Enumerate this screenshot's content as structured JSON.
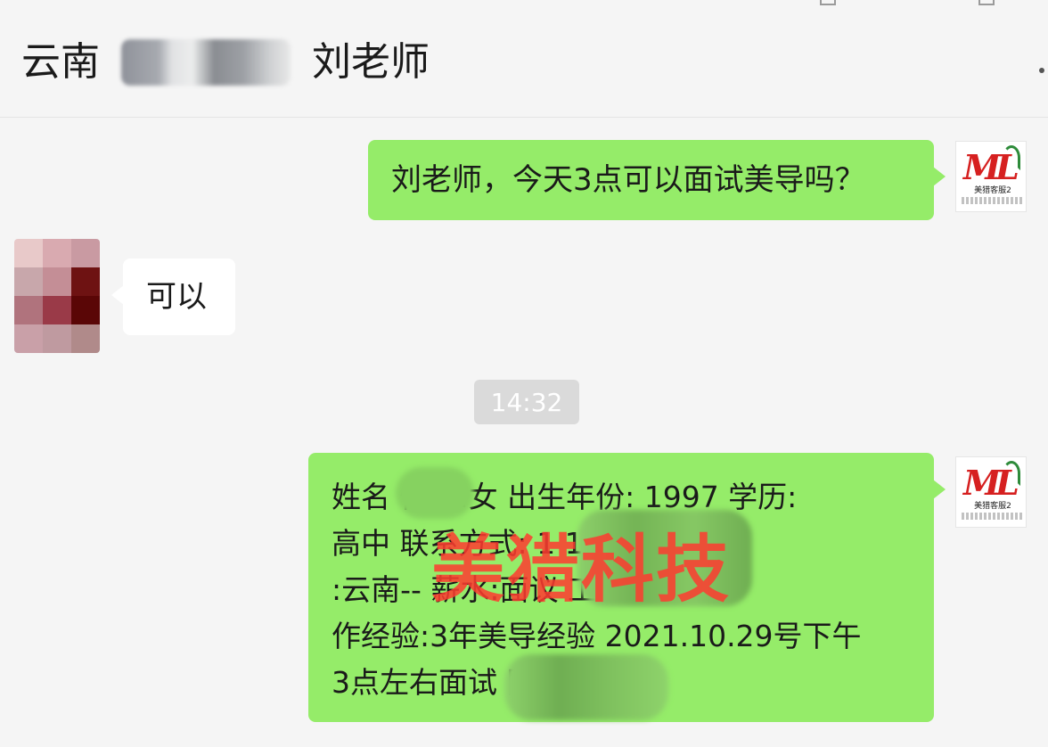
{
  "header": {
    "title_left": "云南",
    "title_right": "刘老师"
  },
  "brand_avatar": {
    "mark": "ML",
    "caption": "美猎客服2"
  },
  "messages": [
    {
      "from": "me",
      "text": "刘老师，今天3点可以面试美导吗？"
    },
    {
      "from": "them",
      "text": "可以"
    }
  ],
  "time_divider": "14:32",
  "long_message": {
    "lines": [
      "姓名       性别:女 出生年份: 1997 学历:",
      "高中 联系方式: 1                    1 工作地点",
      ":云南--                                  薪水:面议 工",
      "作经验:3年美导经验 2021.10.29号下午",
      "3点左右面试                          国际美导"
    ]
  },
  "watermark": "美猎科技",
  "colors": {
    "bubble_mine": "#95ec69",
    "bubble_theirs": "#ffffff",
    "background": "#f5f5f5",
    "watermark": "#ff3b30",
    "brand_red": "#d62020"
  }
}
